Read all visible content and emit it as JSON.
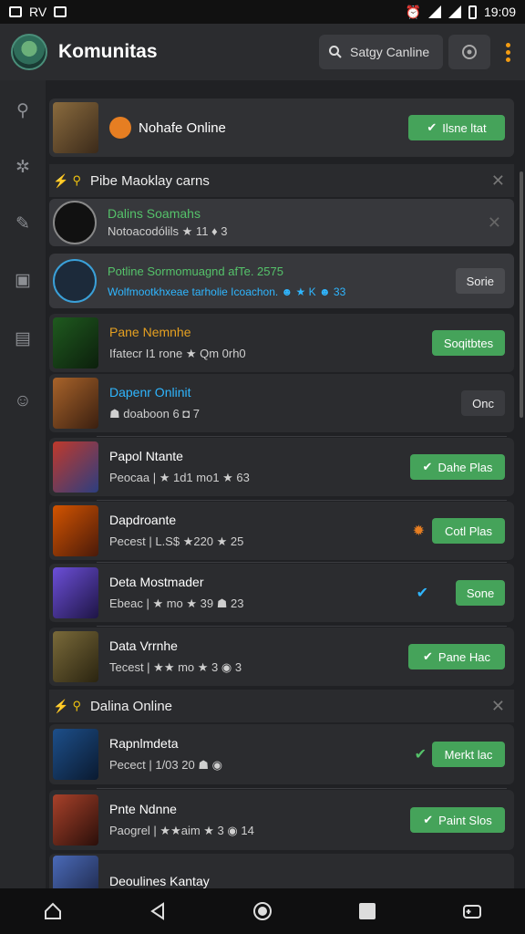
{
  "status": {
    "left_text": "RV",
    "time": "19:09"
  },
  "appbar": {
    "title": "Komunitas",
    "search_label": "Satgy Canline"
  },
  "pinned": {
    "name": "Nohafe Online",
    "button": "Ilsne ltat"
  },
  "section1": {
    "title": "Pibe Maoklay carns"
  },
  "section1_items": [
    {
      "name": "Dalins Soamahs",
      "meta": "Notoacodólils ★ 11 ♦ 3",
      "name_color": "#55c26a"
    },
    {
      "name": "Potline Sormomuagnd afTe. 2575",
      "meta": "Wolfmootkhxeae tarholie Icoachon. ☻ ★ K ☻ 33",
      "button": "Sorie",
      "name_color": "#55c26a",
      "meta_color": "#2fb6ff"
    }
  ],
  "list_items": [
    {
      "name": "Pane Nemnhe",
      "meta": "Ifatecr I1 rone ★ Qm 0rh0",
      "button": "Soqitbtes",
      "name_color": "#e5a021"
    },
    {
      "name": "Dapenr Onlinit",
      "meta": "☗ doaboon 6 ◘ 7",
      "button": "Onc",
      "name_color": "#2fb6ff"
    },
    {
      "name": "Papol Ntante",
      "meta": "Peocaa | ★ 1d1 mo1 ★ 63",
      "button": "Dahe Plas",
      "name_color": "#ffffff"
    },
    {
      "name": "Dapdroante",
      "meta": "Pecest | L.S$ ★220 ★ 25",
      "button": "Cotl Plas",
      "name_color": "#ffffff"
    },
    {
      "name": "Deta Mostmader",
      "meta": "Ebeac | ★ mo ★ 39 ☗ 23",
      "button": "Sone",
      "name_color": "#ffffff"
    },
    {
      "name": "Data Vrrnhe",
      "meta": "Tecest | ★★ mo ★ 3 ◉ 3",
      "button": "Pane Hac",
      "name_color": "#ffffff"
    }
  ],
  "section2": {
    "title": "Dalina Online"
  },
  "section2_items": [
    {
      "name": "Rapnlmdeta",
      "meta": "Pecect | 1/03 20 ☗ ◉",
      "button": "Merkt lac"
    },
    {
      "name": "Pnte Ndnne",
      "meta": "Paogrel | ★★aim ★ 3 ◉ 14",
      "button": "Paint Slos"
    },
    {
      "name": "Deoulines Kantay",
      "meta": "",
      "button": ""
    }
  ]
}
